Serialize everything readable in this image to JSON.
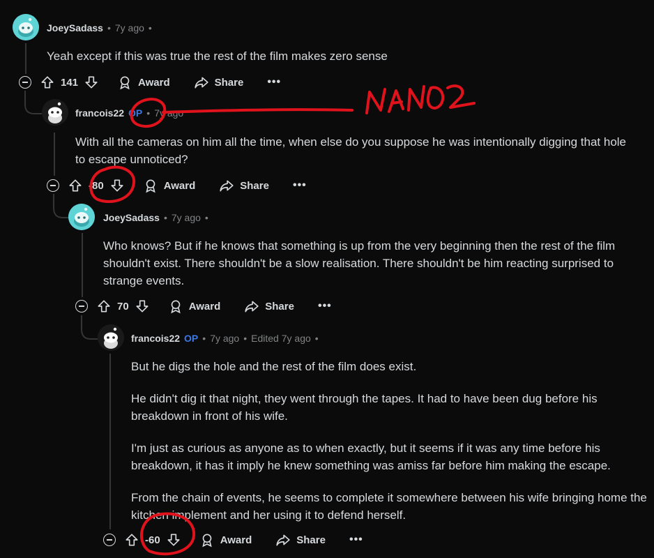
{
  "comments": [
    {
      "username": "JoeySadass",
      "op_badge": "",
      "time": "7y ago",
      "edited": "",
      "paragraphs": [
        "Yeah except if this was true the rest of the film makes zero sense"
      ],
      "score": "141"
    },
    {
      "username": "francois22",
      "op_badge": "OP",
      "time": "7y ago",
      "edited": "",
      "paragraphs": [
        "With all the cameras on him all the time, when else do you suppose he was intentionally digging that hole to escape unnoticed?"
      ],
      "score": "-80"
    },
    {
      "username": "JoeySadass",
      "op_badge": "",
      "time": "7y ago",
      "edited": "",
      "paragraphs": [
        "Who knows? But if he knows that something is up from the very beginning then the rest of the film shouldn't exist. There shouldn't be a slow realisation. There shouldn't be him reacting surprised to strange events."
      ],
      "score": "70"
    },
    {
      "username": "francois22",
      "op_badge": "OP",
      "time": "7y ago",
      "edited": "Edited 7y ago",
      "paragraphs": [
        "But he digs the hole and the rest of the film does exist.",
        "He didn't dig it that night, they went through the tapes. It had to have been dug before his breakdown in front of his wife.",
        "I'm just as curious as anyone as to when exactly, but it seems if it was any time before his breakdown, it has it imply he knew something was amiss far before him making the escape.",
        "From the chain of events, he seems to complete it somewhere between his wife bringing home the kitchen implement and her using it to defend herself."
      ],
      "score": "-60"
    }
  ],
  "actions": {
    "award": "Award",
    "share": "Share",
    "more": "•••"
  },
  "separator": "•",
  "annotation": {
    "text": "NANOS",
    "color": "#e0121b"
  },
  "colors": {
    "background": "#0b0b0c",
    "text": "#d7dadc",
    "op_blue": "#3c79e6",
    "muted": "#818384"
  }
}
